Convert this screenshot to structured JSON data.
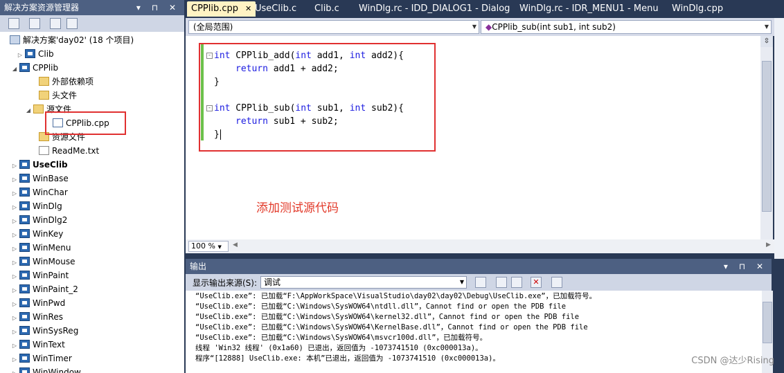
{
  "solution_explorer": {
    "title": "解决方案资源管理器",
    "controls": "▾ ⊓ ✕",
    "solution_label": "解决方案'day02' (18 个项目)",
    "items": [
      {
        "label": "Clib",
        "type": "project"
      },
      {
        "label": "CPPlib",
        "type": "project"
      },
      {
        "label": "外部依赖项",
        "type": "folder"
      },
      {
        "label": "头文件",
        "type": "folder"
      },
      {
        "label": "源文件",
        "type": "folder"
      },
      {
        "label": "CPPlib.cpp",
        "type": "cpp"
      },
      {
        "label": "资源文件",
        "type": "folder"
      },
      {
        "label": "ReadMe.txt",
        "type": "file"
      },
      {
        "label": "UseClib",
        "type": "project"
      },
      {
        "label": "WinBase",
        "type": "project"
      },
      {
        "label": "WinChar",
        "type": "project"
      },
      {
        "label": "WinDlg",
        "type": "project"
      },
      {
        "label": "WinDlg2",
        "type": "project"
      },
      {
        "label": "WinKey",
        "type": "project"
      },
      {
        "label": "WinMenu",
        "type": "project"
      },
      {
        "label": "WinMouse",
        "type": "project"
      },
      {
        "label": "WinPaint",
        "type": "project"
      },
      {
        "label": "WinPaint_2",
        "type": "project"
      },
      {
        "label": "WinPwd",
        "type": "project"
      },
      {
        "label": "WinRes",
        "type": "project"
      },
      {
        "label": "WinSysReg",
        "type": "project"
      },
      {
        "label": "WinText",
        "type": "project"
      },
      {
        "label": "WinTimer",
        "type": "project"
      },
      {
        "label": "WinWindow",
        "type": "project"
      }
    ]
  },
  "tabs": [
    {
      "label": "CPPlib.cpp",
      "active": true
    },
    {
      "label": "UseClib.c"
    },
    {
      "label": "Clib.c"
    },
    {
      "label": "WinDlg.rc - IDD_DIALOG1 - Dialog"
    },
    {
      "label": "WinDlg.rc - IDR_MENU1 - Menu"
    },
    {
      "label": "WinDlg.cpp"
    }
  ],
  "tab_close": "✕",
  "nav": {
    "scope": "(全局范围)",
    "function": "CPPlib_sub(int sub1, int sub2)"
  },
  "code": {
    "l1_kw1": "int",
    "l1_rest1": " CPPlib_add(",
    "l1_kw2": "int",
    "l1_rest2": " add1, ",
    "l1_kw3": "int",
    "l1_rest3": " add2){",
    "l2_kw": "return",
    "l2_rest": " add1 + add2;",
    "l3": "}",
    "l5_kw1": "int",
    "l5_rest1": " CPPlib_sub(",
    "l5_kw2": "int",
    "l5_rest2": " sub1, ",
    "l5_kw3": "int",
    "l5_rest3": " sub2){",
    "l6_kw": "return",
    "l6_rest": " sub1 + sub2;",
    "l7": "}"
  },
  "annotation": "添加测试源代码",
  "zoom": "100 %",
  "output": {
    "title": "输出",
    "controls": "▾ ⊓ ✕",
    "source_label": "显示输出来源(S):",
    "source_value": "调试",
    "lines": [
      "“UseClib.exe”: 已加载“F:\\AppWorkSpace\\VisualStudio\\day02\\day02\\Debug\\UseClib.exe”，已加载符号。",
      "“UseClib.exe”: 已加载“C:\\Windows\\SysWOW64\\ntdll.dll”，Cannot find or open the PDB file",
      "“UseClib.exe”: 已加载“C:\\Windows\\SysWOW64\\kernel32.dll”，Cannot find or open the PDB file",
      "“UseClib.exe”: 已加载“C:\\Windows\\SysWOW64\\KernelBase.dll”，Cannot find or open the PDB file",
      "“UseClib.exe”: 已加载“C:\\Windows\\SysWOW64\\msvcr100d.dll”，已加载符号。",
      "线程 'Win32 线程' (0x1a60) 已退出，返回值为 -1073741510 (0xc000013a)。",
      "程序“[12888] UseClib.exe: 本机”已退出，返回值为 -1073741510 (0xc000013a)。"
    ]
  },
  "watermark": "CSDN @达少Rising",
  "colors": {
    "frame": "#293955",
    "panel_header": "#4d6082",
    "active_tab": "#fff3c4",
    "keyword": "#1a1ae0",
    "highlight_box": "#e03030",
    "annotation": "#e23a2a",
    "change_margin": "#6cc04a"
  }
}
